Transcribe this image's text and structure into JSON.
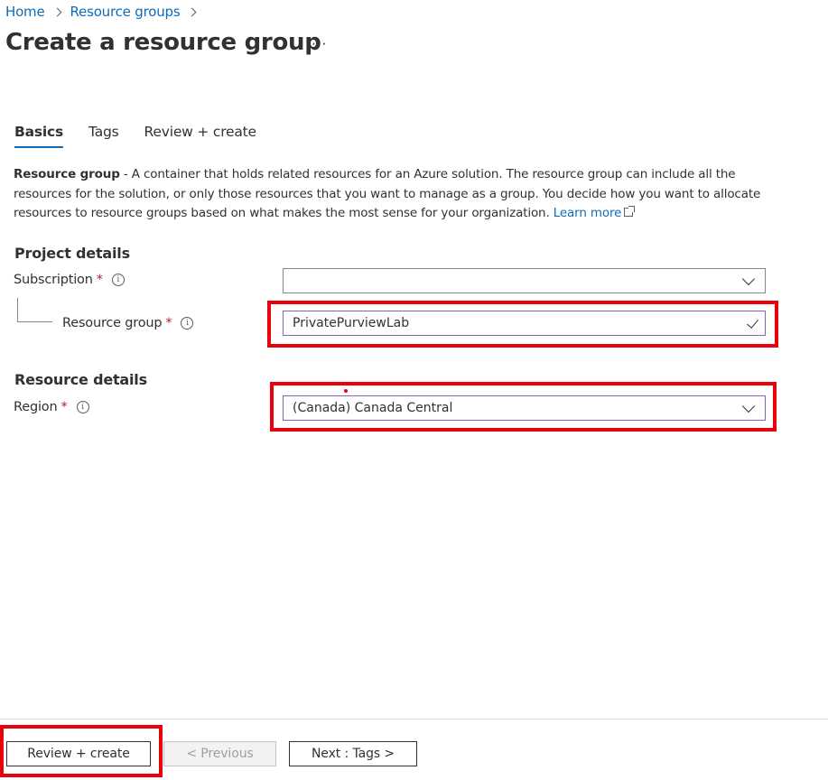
{
  "breadcrumb": {
    "items": [
      "Home",
      "Resource groups"
    ]
  },
  "page": {
    "title": "Create a resource group",
    "more_label": "···"
  },
  "tabs": [
    {
      "label": "Basics",
      "active": true
    },
    {
      "label": "Tags",
      "active": false
    },
    {
      "label": "Review + create",
      "active": false
    }
  ],
  "description": {
    "strong": "Resource group",
    "text": " - A container that holds related resources for an Azure solution. The resource group can include all the resources for the solution, or only those resources that you want to manage as a group. You decide how you want to allocate resources to resource groups based on what makes the most sense for your organization. ",
    "link": "Learn more"
  },
  "project_details": {
    "heading": "Project details",
    "subscription": {
      "label": "Subscription",
      "required": "*",
      "value": ""
    },
    "resource_group": {
      "label": "Resource group",
      "required": "*",
      "value": "PrivatePurviewLab"
    }
  },
  "resource_details": {
    "heading": "Resource details",
    "region": {
      "label": "Region",
      "required": "*",
      "value": "(Canada) Canada Central"
    }
  },
  "footer": {
    "review_create": "Review + create",
    "previous": "< Previous",
    "next": "Next : Tags >"
  },
  "colors": {
    "accent": "#0f6cbd",
    "highlight": "#e8000b",
    "focus_border": "#8764b8",
    "required": "#a4262c"
  },
  "icons": {
    "info": "info-circle-icon",
    "chevron": "chevron-down-icon",
    "check": "checkmark-icon",
    "external": "external-link-icon"
  }
}
